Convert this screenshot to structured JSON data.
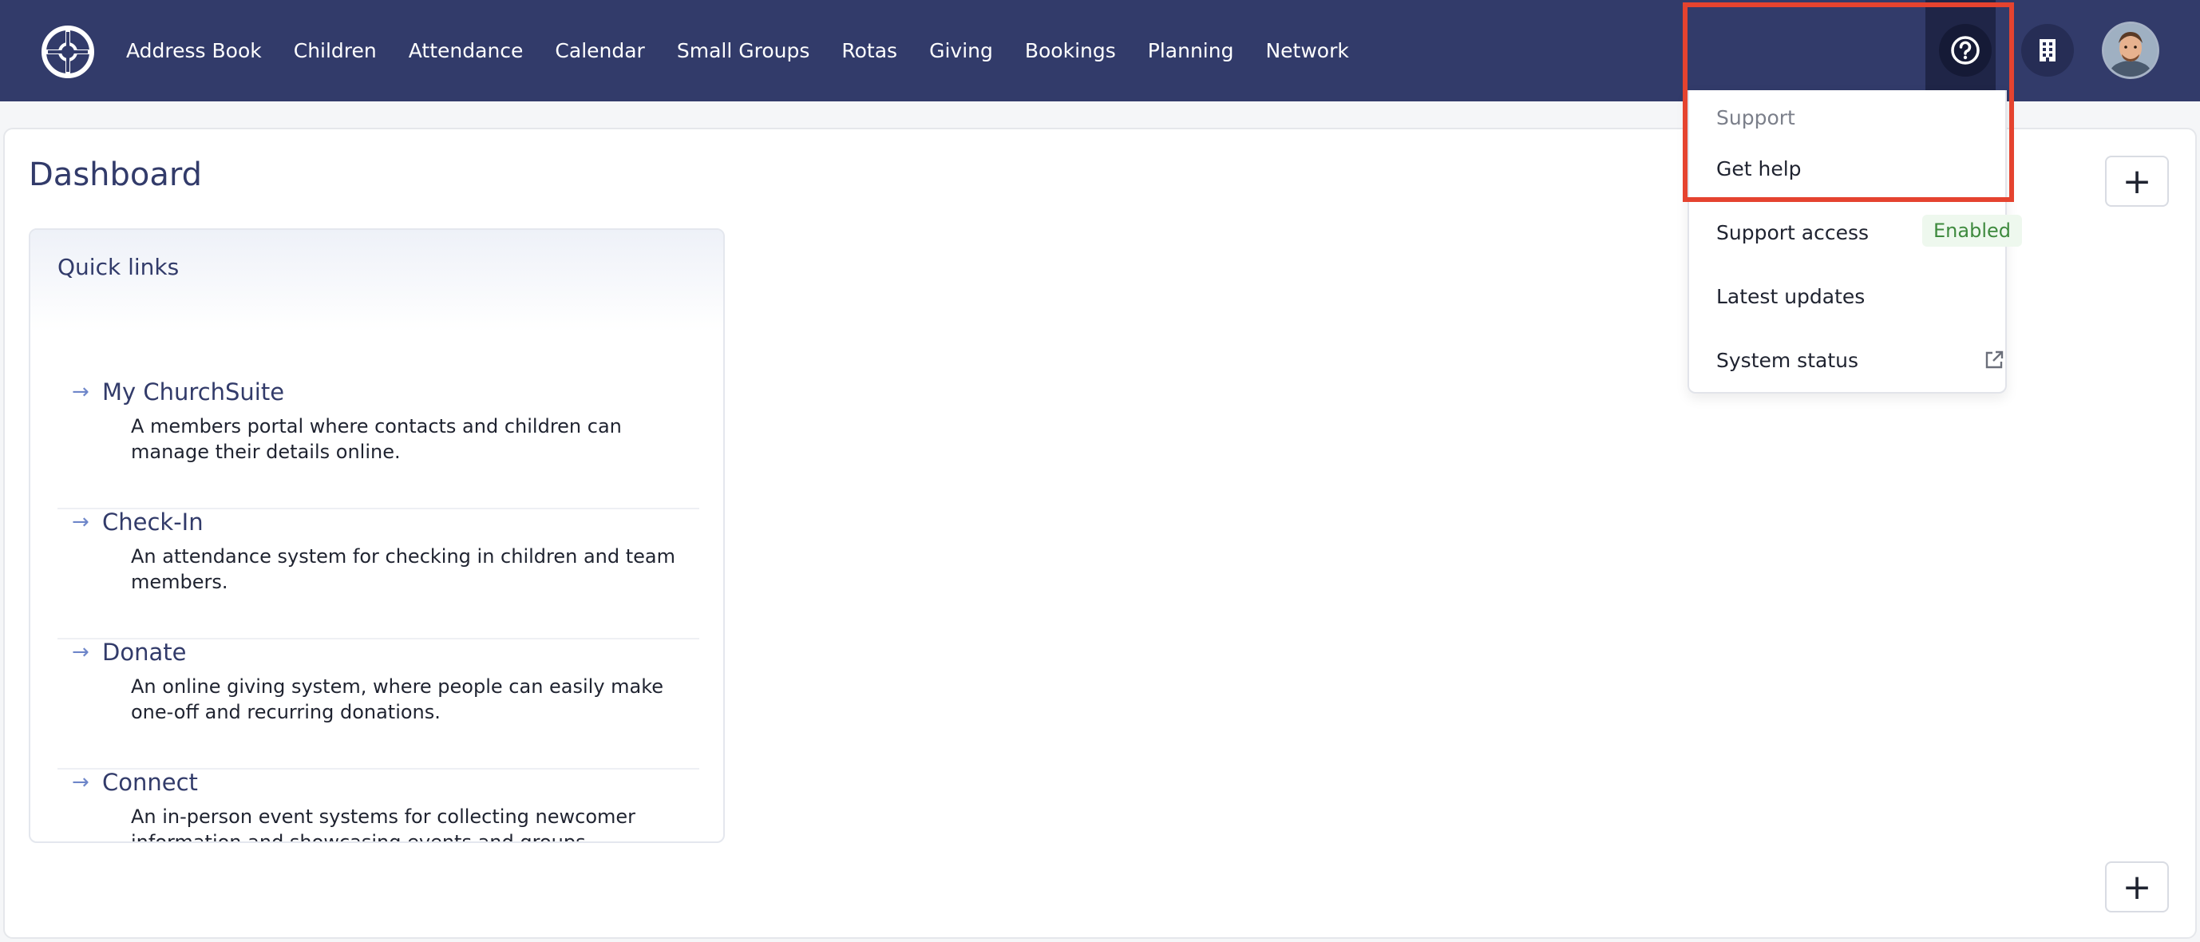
{
  "nav": {
    "items": [
      "Address Book",
      "Children",
      "Attendance",
      "Calendar",
      "Small Groups",
      "Rotas",
      "Giving",
      "Bookings",
      "Planning",
      "Network"
    ]
  },
  "icons": {
    "logo": "churchsuite-logo-icon",
    "help": "question-circle-icon",
    "building": "building-icon",
    "avatar": "user-avatar",
    "arrow": "arrow-right-icon",
    "external": "external-link-icon"
  },
  "page": {
    "title": "Dashboard",
    "add_symbol": "+"
  },
  "quick_links": {
    "title": "Quick links",
    "items": [
      {
        "title": "My ChurchSuite",
        "description": "A members portal where contacts and children can manage their details online."
      },
      {
        "title": "Check-In",
        "description": "An attendance system for checking in children and team members."
      },
      {
        "title": "Donate",
        "description": "An online giving system, where people can easily make one-off and recurring donations."
      },
      {
        "title": "Connect",
        "description": "An in-person event systems for collecting newcomer information and showcasing events and groups."
      }
    ]
  },
  "support_menu": {
    "label": "Support",
    "get_help": "Get help",
    "support_access": "Support access",
    "support_access_status": "Enabled",
    "latest_updates": "Latest updates",
    "system_status": "System status"
  },
  "colors": {
    "topbar": "#323b6a",
    "accent": "#323b6a",
    "highlight": "#e5432f",
    "enabled": "#3e8a3e"
  }
}
